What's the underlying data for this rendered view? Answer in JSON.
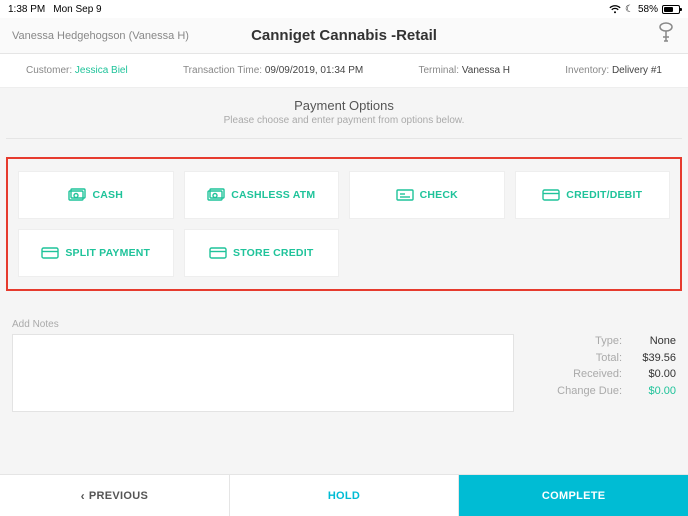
{
  "status": {
    "time": "1:38 PM",
    "date": "Mon Sep 9",
    "battery_pct": "58%"
  },
  "header": {
    "user": "Vanessa Hedgehogson (Vanessa H)",
    "title": "Canniget Cannabis -Retail"
  },
  "info": {
    "customer_label": "Customer:",
    "customer_value": "Jessica Biel",
    "transaction_label": "Transaction Time:",
    "transaction_value": "09/09/2019, 01:34 PM",
    "terminal_label": "Terminal:",
    "terminal_value": "Vanessa H",
    "inventory_label": "Inventory:",
    "inventory_value": "Delivery #1"
  },
  "section": {
    "title": "Payment Options",
    "subtitle": "Please choose and enter payment from options below."
  },
  "options": {
    "cash": "CASH",
    "cashless_atm": "CASHLESS ATM",
    "check": "CHECK",
    "credit_debit": "CREDIT/DEBIT",
    "split_payment": "SPLIT PAYMENT",
    "store_credit": "STORE CREDIT"
  },
  "notes": {
    "label": "Add Notes",
    "value": ""
  },
  "totals": {
    "type_label": "Type:",
    "type_value": "None",
    "total_label": "Total:",
    "total_value": "$39.56",
    "received_label": "Received:",
    "received_value": "$0.00",
    "change_label": "Change Due:",
    "change_value": "$0.00"
  },
  "bottom": {
    "previous": "PREVIOUS",
    "hold": "HOLD",
    "complete": "COMPLETE"
  }
}
